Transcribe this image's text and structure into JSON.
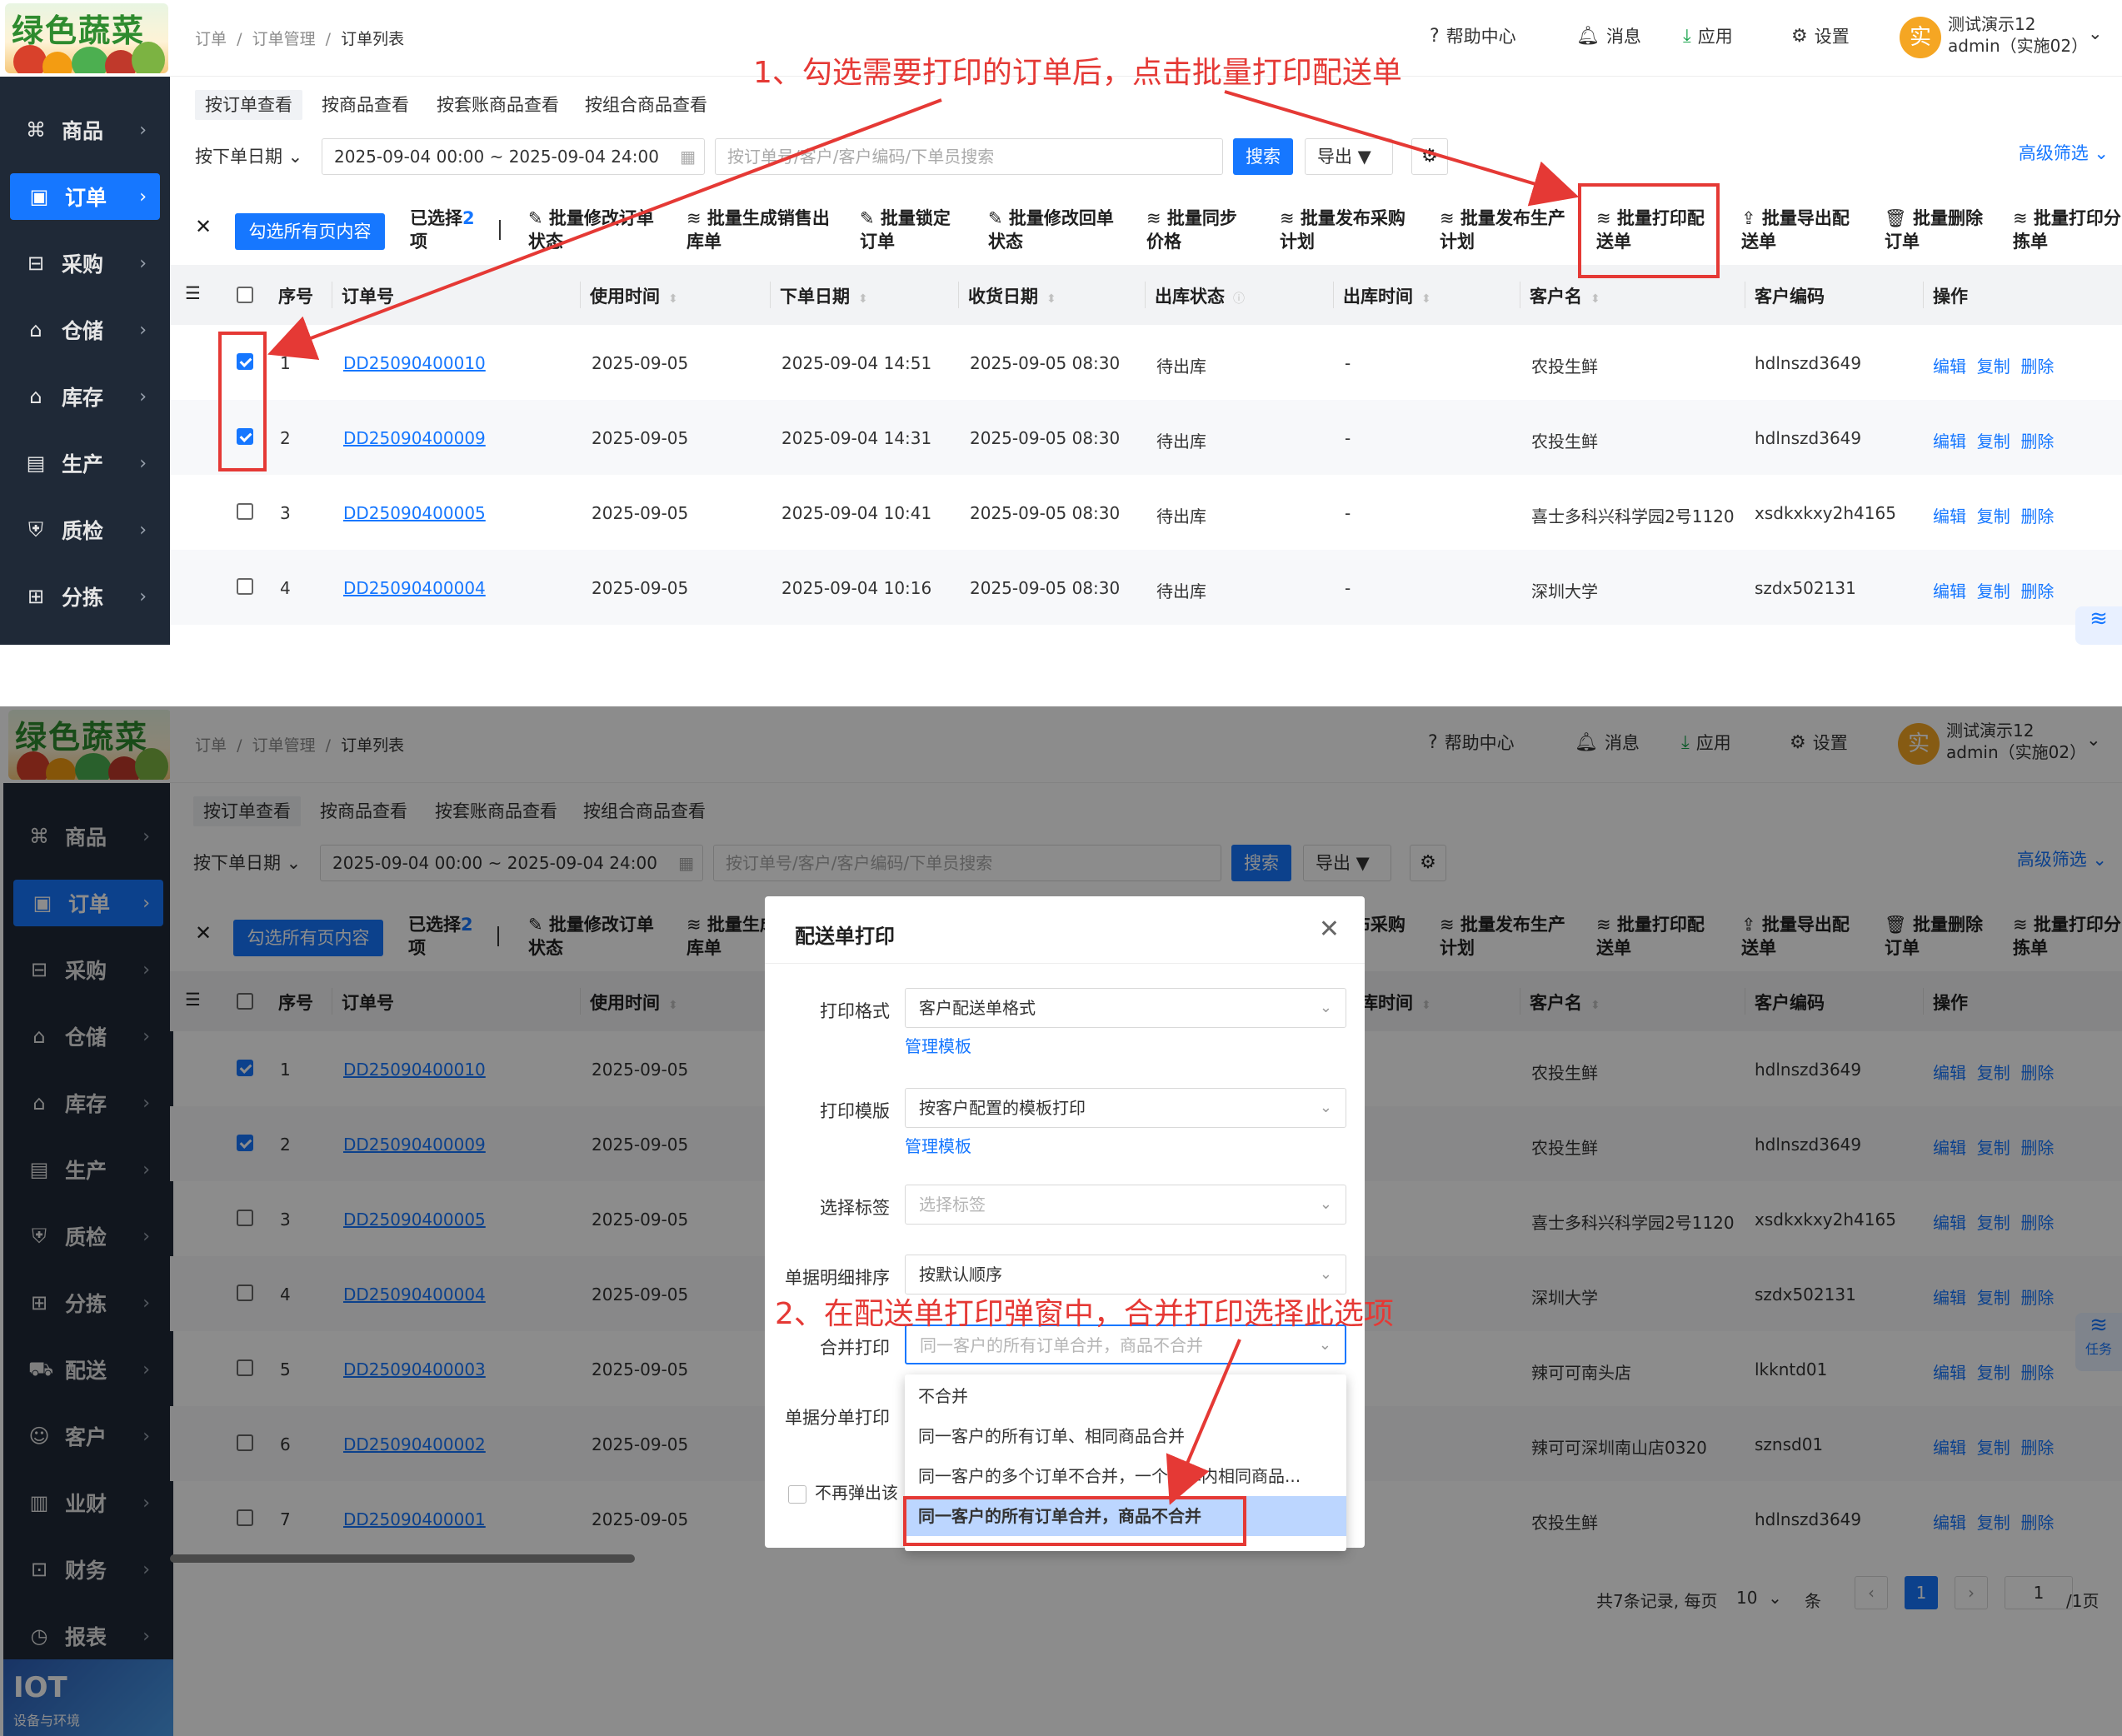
{
  "app": {
    "logo_text": "绿色蔬菜",
    "breadcrumb": [
      "订单",
      "订单管理",
      "订单列表"
    ],
    "top_right": {
      "help": "帮助中心",
      "messages": "消息",
      "apps": "应用",
      "settings": "设置",
      "avatar_char": "实",
      "user_line1": "测试演示12",
      "user_line2": "admin（实施02）"
    },
    "sidebar_top": [
      "商品",
      "订单",
      "采购",
      "仓储",
      "库存",
      "生产",
      "质检",
      "分拣"
    ],
    "sidebar_bottom": [
      "商品",
      "订单",
      "采购",
      "仓储",
      "库存",
      "生产",
      "质检",
      "分拣",
      "配送",
      "客户",
      "业财",
      "财务",
      "报表"
    ],
    "iot": {
      "title": "IOT",
      "subtitle": "设备与环境"
    },
    "tabs": [
      "按订单查看",
      "按商品查看",
      "按套账商品查看",
      "按组合商品查看"
    ],
    "filter": {
      "date_type": "按下单日期",
      "date_range": "2025-09-04 00:00 ~ 2025-09-04 24:00",
      "search_placeholder": "按订单号/客户/客户编码/下单员搜索",
      "search_btn": "搜索",
      "export_btn": "导出",
      "advanced": "高级筛选"
    },
    "batch": {
      "select_all": "勾选所有页内容",
      "selected_label": "已选择",
      "selected_count": "2",
      "selected_unit": "项",
      "actions": [
        [
          "批量修改订单",
          "状态"
        ],
        [
          "批量生成销售出",
          "库单"
        ],
        [
          "批量锁定",
          "订单"
        ],
        [
          "批量修改回单",
          "状态"
        ],
        [
          "批量同步",
          "价格"
        ],
        [
          "批量发布采购",
          "计划"
        ],
        [
          "批量发布生产",
          "计划"
        ],
        [
          "批量打印配",
          "送单"
        ],
        [
          "批量导出配",
          "送单"
        ],
        [
          "批量删除",
          "订单"
        ],
        [
          "批量打印分",
          "拣单"
        ]
      ]
    },
    "columns": [
      "序号",
      "订单号",
      "使用时间",
      "下单日期",
      "收货日期",
      "出库状态",
      "出库时间",
      "客户名",
      "客户编码",
      "操作"
    ],
    "rows": [
      {
        "no": "1",
        "order": "DD25090400010",
        "use": "2025-09-05",
        "date": "2025-09-04 14:51",
        "recv": "2025-09-05 08:30",
        "status": "待出库",
        "out": "-",
        "customer": "农投生鲜",
        "code": "hdlnszd3649",
        "checked": true
      },
      {
        "no": "2",
        "order": "DD25090400009",
        "use": "2025-09-05",
        "date": "2025-09-04 14:31",
        "recv": "2025-09-05 08:30",
        "status": "待出库",
        "out": "-",
        "customer": "农投生鲜",
        "code": "hdlnszd3649",
        "checked": true
      },
      {
        "no": "3",
        "order": "DD25090400005",
        "use": "2025-09-05",
        "date": "2025-09-04 10:41",
        "recv": "2025-09-05 08:30",
        "status": "待出库",
        "out": "-",
        "customer": "喜士多科兴科学园2号1120",
        "code": "xsdkxkxy2h4165",
        "checked": false
      },
      {
        "no": "4",
        "order": "DD25090400004",
        "use": "2025-09-05",
        "date": "2025-09-04 10:16",
        "recv": "2025-09-05 08:30",
        "status": "待出库",
        "out": "-",
        "customer": "深圳大学",
        "code": "szdx502131",
        "checked": false
      },
      {
        "no": "5",
        "order": "DD25090400003",
        "use": "2025-09-05",
        "customer": "辣可可南头店",
        "code": "lkkntd01",
        "checked": false
      },
      {
        "no": "6",
        "order": "DD25090400002",
        "use": "2025-09-05",
        "customer": "辣可可深圳南山店0320",
        "code": "sznsd01",
        "checked": false
      },
      {
        "no": "7",
        "order": "DD25090400001",
        "use": "2025-09-05",
        "customer": "农投生鲜",
        "code": "hdlnszd3649",
        "checked": false
      }
    ],
    "ops": [
      "编辑",
      "复制",
      "删除"
    ],
    "float_task": "任务"
  },
  "annotations": {
    "step1": "1、勾选需要打印的订单后，点击批量打印配送单",
    "step2": "2、在配送单打印弹窗中，合并打印选择此选项"
  },
  "modal": {
    "title": "配送单打印",
    "fields": [
      {
        "label": "打印格式",
        "value": "客户配送单格式",
        "link": "管理模板"
      },
      {
        "label": "打印模版",
        "value": "按客户配置的模板打印",
        "link": "管理模板"
      },
      {
        "label": "选择标签",
        "placeholder": "选择标签"
      },
      {
        "label": "单据明细排序",
        "value": "按默认顺序"
      },
      {
        "label": "合并打印",
        "placeholder": "同一客户的所有订单合并，商品不合并"
      },
      {
        "label": "单据分单打印"
      }
    ],
    "dropdown": [
      "不合并",
      "同一客户的所有订单、相同商品合并",
      "同一客户的多个订单不合并，一个订单内相同商品...",
      "同一客户的所有订单合并，商品不合并"
    ],
    "no_popup": "不再弹出该"
  },
  "pager": {
    "total": "共7条记录, 每页",
    "size": "10",
    "unit": "条",
    "page": "1",
    "jump": "1",
    "pages": "/1页"
  },
  "colors": {
    "primary": "#1677ff",
    "sidebar": "#1f2937",
    "annotation": "#e53935"
  }
}
